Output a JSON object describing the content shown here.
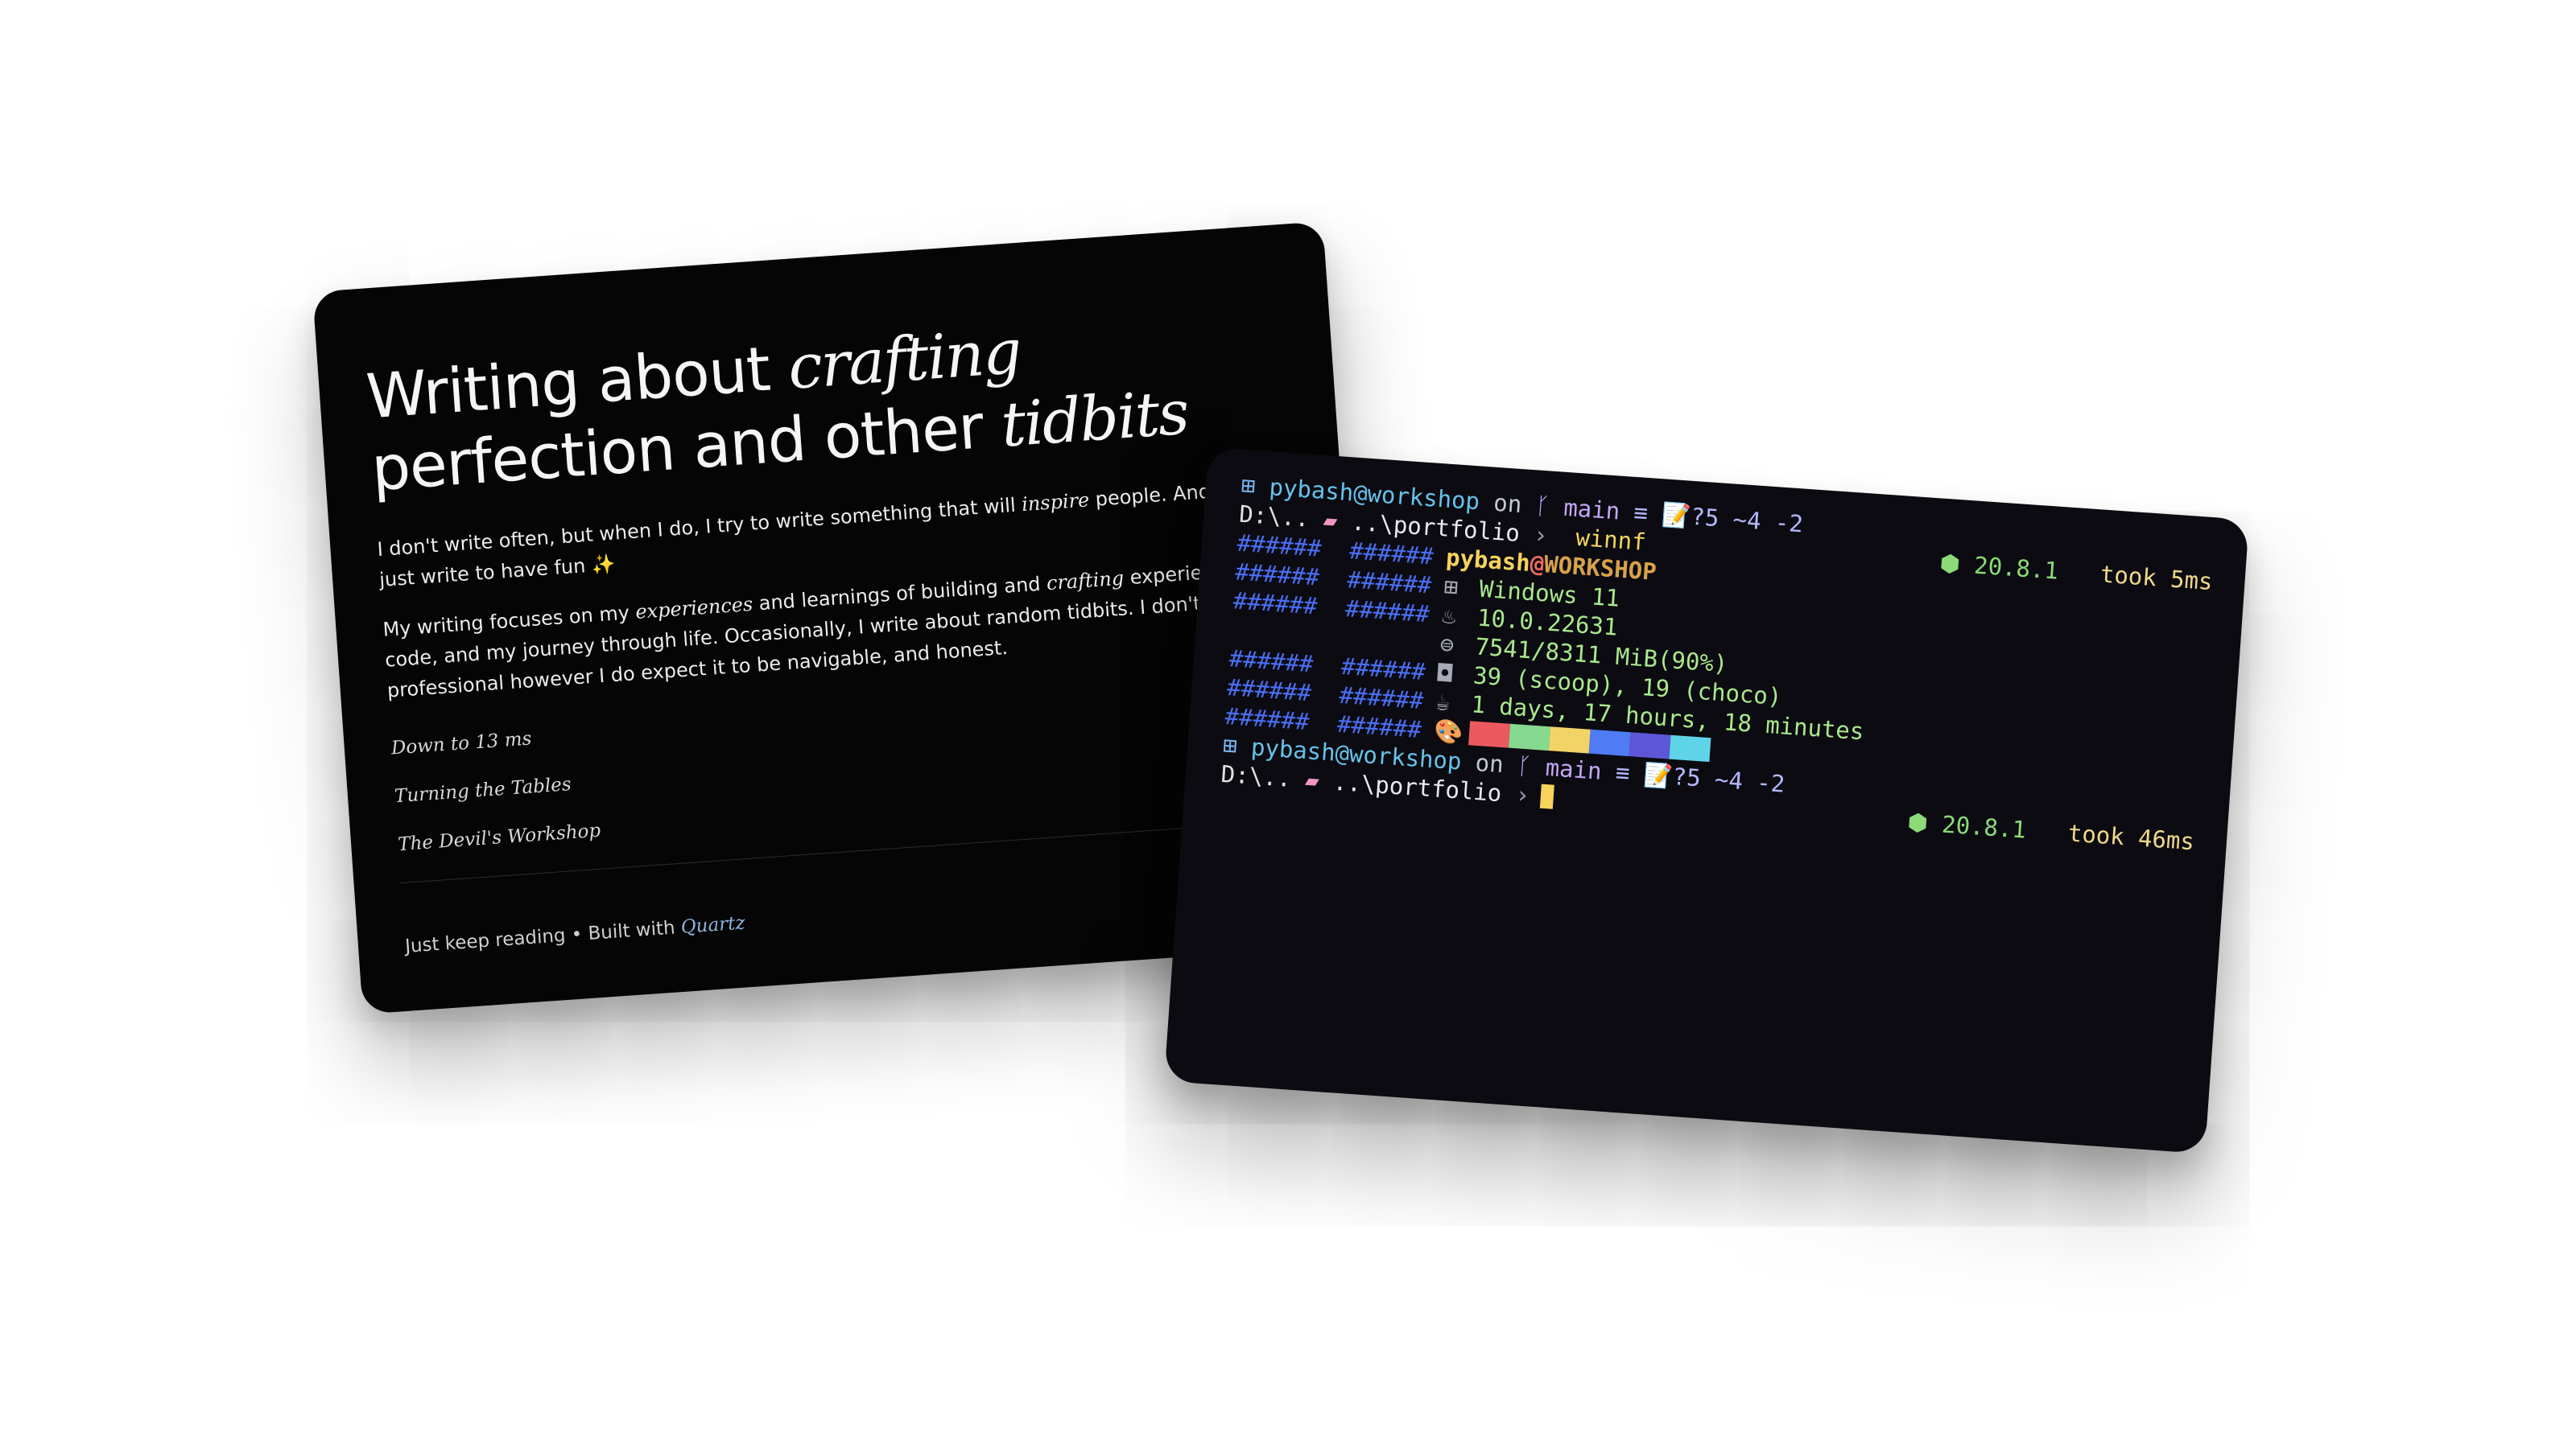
{
  "blog": {
    "title_part1": "Writing about ",
    "title_emph1": "crafting",
    "title_part2": " perfection and other ",
    "title_emph2": "tidbits",
    "intro": {
      "text1": "I don't write often, but when I do, I try to write something that will ",
      "emph": "inspire",
      "text2": " people. And sometimes, I just write to have fun ",
      "emoji": "✨"
    },
    "about": {
      "text1": "My writing focuses on my ",
      "emph1": "experiences",
      "text2": " and learnings of building and ",
      "emph2": "crafting",
      "text3": " experiences through code, and my journey through life. Occasionally, I write about random tidbits. I don't expect this to be professional however I do expect it to be navigable, and honest."
    },
    "posts": [
      "Down to 13 ms",
      "Turning the Tables",
      "The Devil's Workshop"
    ],
    "footer_text": "Just keep reading • Built with ",
    "footer_link": "Quartz"
  },
  "terminal": {
    "prompt1": {
      "icon": "windows-icon",
      "user": "pybash@workshop",
      "on": " on ",
      "branch_icon": "git-branch-icon",
      "branch": "main",
      "status": "≡ 📝?5 ~4 -2",
      "path_lead": "D:\\..",
      "folder_icon": "folder-icon",
      "path": "..\\portfolio",
      "chevron": "›",
      "command": "winnf",
      "node": "⬢ 20.8.1",
      "took": "took 5ms"
    },
    "fetch": {
      "logo_block": "######  ######",
      "host_user": "pybash",
      "host_at": "@",
      "host_name": "WORKSHOP",
      "items": [
        {
          "icon": "os-icon",
          "glyph": "⊞",
          "value": "Windows 11"
        },
        {
          "icon": "kernel-icon",
          "glyph": "♨",
          "value": "10.0.22631"
        },
        {
          "icon": "memory-icon",
          "glyph": "⊜",
          "value": "7541/8311 MiB(90%)"
        },
        {
          "icon": "package-icon",
          "glyph": "◘",
          "value": "39 (scoop), 19 (choco)"
        },
        {
          "icon": "uptime-icon",
          "glyph": "☕",
          "value": "1 days, 17 hours, 18 minutes"
        }
      ],
      "palette_icon": "palette-icon",
      "palette_glyph": "🎨",
      "palette_colors": [
        "#ec5a5f",
        "#87d98f",
        "#f2d366",
        "#4f7cf5",
        "#5d57d8",
        "#5fd4e8"
      ]
    },
    "prompt2": {
      "icon": "windows-icon",
      "user": "pybash@workshop",
      "on": " on ",
      "branch_icon": "git-branch-icon",
      "branch": "main",
      "status": "≡ 📝?5 ~4 -2",
      "path_lead": "D:\\..",
      "folder_icon": "folder-icon",
      "path": "..\\portfolio",
      "chevron": "›",
      "node": "⬢ 20.8.1",
      "took": "took 46ms"
    }
  }
}
